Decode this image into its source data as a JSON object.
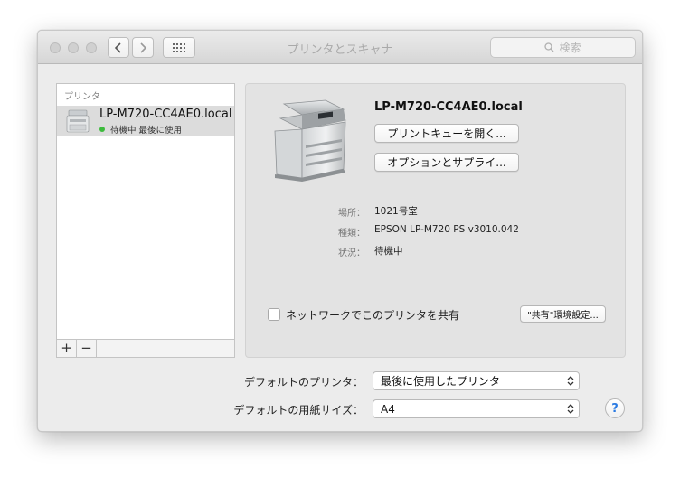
{
  "window": {
    "title": "プリンタとスキャナ",
    "search_placeholder": "検索"
  },
  "sidebar": {
    "header": "プリンタ",
    "printers": [
      {
        "name": "LP-M720-CC4AE0.local",
        "status": "待機中 最後に使用",
        "status_color": "#3dbb3d"
      }
    ],
    "add_label": "+",
    "remove_label": "−"
  },
  "detail": {
    "printer_name": "LP-M720-CC4AE0.local",
    "open_queue_button": "プリントキューを開く...",
    "options_button": "オプションとサプライ...",
    "info": [
      {
        "label": "場所：",
        "value": "1021号室"
      },
      {
        "label": "種類：",
        "value": "EPSON LP-M720 PS v3010.042"
      },
      {
        "label": "状況：",
        "value": "待機中"
      }
    ],
    "share_checkbox_label": "ネットワークでこのプリンタを共有",
    "share_checked": false,
    "sharing_prefs_button": "\"共有\"環境設定..."
  },
  "defaults": {
    "default_printer_label": "デフォルトのプリンタ：",
    "default_printer_value": "最後に使用したプリンタ",
    "default_paper_label": "デフォルトの用紙サイズ：",
    "default_paper_value": "A4",
    "help_label": "?"
  },
  "icons": {
    "back": "chevron-left-icon",
    "forward": "chevron-right-icon",
    "grid": "grid-icon",
    "search": "search-icon",
    "help": "help-icon"
  }
}
